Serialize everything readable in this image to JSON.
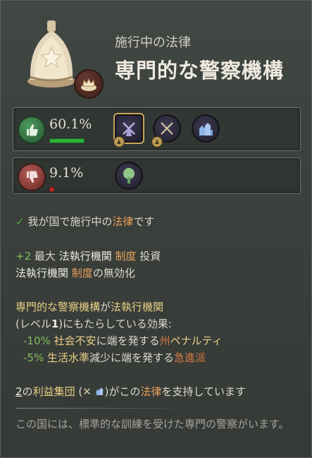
{
  "header": {
    "subtitle": "施行中の法律",
    "title": "専門的な警察機構",
    "icons": [
      "police-helmet-icon",
      "crown-cushion-icon"
    ]
  },
  "approval": {
    "percent": "60.1%",
    "bar_fraction": 0.601,
    "groups": [
      "windmill-icon",
      "crossed-swords-icon",
      "town-buildings-icon"
    ]
  },
  "disapproval": {
    "percent": "9.1%",
    "bar_fraction": 0.091,
    "groups": [
      "tree-icon"
    ]
  },
  "status": {
    "check": "✓",
    "prefix": "我が国で施行中の",
    "law_word": "法律",
    "suffix": "です"
  },
  "effect1": {
    "value": "+2",
    "max": "最大",
    "institution": "法執行機関",
    "institution_word": "制度",
    "investment": "投資"
  },
  "effect2": {
    "institution": "法執行機関",
    "institution_word": "制度",
    "suffix": "の無効化"
  },
  "effect3": {
    "line1_a": "専門的な警察機構",
    "line1_b": "が",
    "line1_c": "法執行機関",
    "line2_a": "(レベル",
    "line2_b": "1",
    "line2_c": ")にもたらしている効果:",
    "mod1_value": "-10%",
    "mod1_a": "社会不安",
    "mod1_b": "に端を発する",
    "mod1_c": "州",
    "mod1_d": "ペナルティ",
    "mod2_value": "-5%",
    "mod2_a": "生活水準",
    "mod2_b": "減少に端を発する",
    "mod2_c": "急進派"
  },
  "support": {
    "count": "2",
    "a": "の",
    "groups": "利益集団",
    "open": " (",
    "close": ")がこの",
    "law_word": "法律",
    "suffix": "を支持しています"
  },
  "flavor": "この国には、標準的な訓練を受けた専門の警察がいます。",
  "colors": {
    "accent_green": "#7fbf5a",
    "law_orange": "#e8a05a",
    "highlight_yellow": "#e8d084",
    "penalty_rust": "#d8783f",
    "approve_bar": "#2fb23a",
    "disapprove_bar": "#c52a2a"
  }
}
